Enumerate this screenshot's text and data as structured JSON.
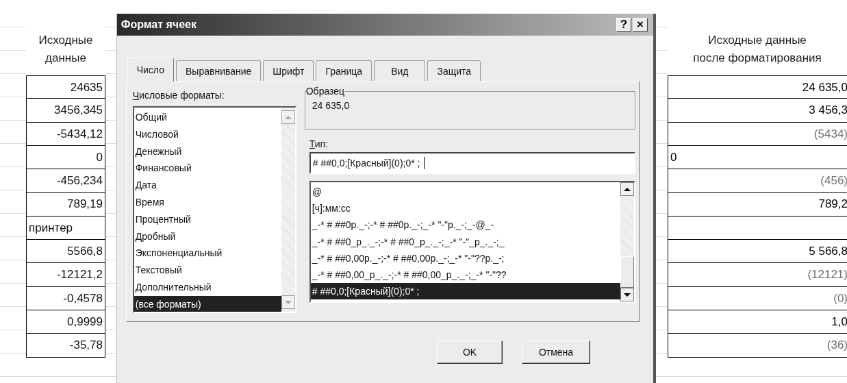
{
  "sheet_left": {
    "header": "Исходные\nданные",
    "cells": [
      {
        "text": "24635",
        "kind": "number"
      },
      {
        "text": "3456,345",
        "kind": "number"
      },
      {
        "text": "-5434,12",
        "kind": "number"
      },
      {
        "text": "0",
        "kind": "number"
      },
      {
        "text": "-456,234",
        "kind": "number"
      },
      {
        "text": "789,19",
        "kind": "number"
      },
      {
        "text": "принтер",
        "kind": "text"
      },
      {
        "text": "5566,8",
        "kind": "number"
      },
      {
        "text": "-12121,2",
        "kind": "number"
      },
      {
        "text": "-0,4578",
        "kind": "number"
      },
      {
        "text": "0,9999",
        "kind": "number"
      },
      {
        "text": "-35,78",
        "kind": "number"
      }
    ]
  },
  "dialog": {
    "title": "Формат ячеек",
    "help_button": "?",
    "close_button": "×",
    "tabs": [
      {
        "label": "Число",
        "selected": true
      },
      {
        "label": "Выравнивание",
        "selected": false
      },
      {
        "label": "Шрифт",
        "selected": false
      },
      {
        "label": "Граница",
        "selected": false
      },
      {
        "label": "Вид",
        "selected": false
      },
      {
        "label": "Защита",
        "selected": false
      }
    ],
    "categories_label": "Числовые форматы:",
    "categories": [
      {
        "label": "Общий",
        "selected": false
      },
      {
        "label": "Числовой",
        "selected": false
      },
      {
        "label": "Денежный",
        "selected": false
      },
      {
        "label": "Финансовый",
        "selected": false
      },
      {
        "label": "Дата",
        "selected": false
      },
      {
        "label": "Время",
        "selected": false
      },
      {
        "label": "Процентный",
        "selected": false
      },
      {
        "label": "Дробный",
        "selected": false
      },
      {
        "label": "Экспоненциальный",
        "selected": false
      },
      {
        "label": "Текстовый",
        "selected": false
      },
      {
        "label": "Дополнительный",
        "selected": false
      },
      {
        "label": "(все форматы)",
        "selected": true
      }
    ],
    "sample_label": "Образец",
    "sample_value": "24 635,0",
    "type_label": "Тип:",
    "type_value": "# ##0,0;[Красный](0);0* ;",
    "type_list": [
      {
        "label": "@",
        "selected": false
      },
      {
        "label": "[ч]:мм:сс",
        "selected": false
      },
      {
        "label": "_-* # ##0р._-;-* # ##0р._-;_-* \"-\"р._-;_-@_-",
        "selected": false
      },
      {
        "label": "_-* # ##0_р_._-;-* # ##0_р_._-;_-* \"-\"_р_._-;_",
        "selected": false
      },
      {
        "label": "_-* # ##0,00р._-;-* # ##0,00р._-;_-* \"-\"??р._-;",
        "selected": false
      },
      {
        "label": "_-* # ##0,00_р_._-;-* # ##0,00_р_._-;_-* \"-\"??",
        "selected": false
      },
      {
        "label": "# ##0,0;[Красный](0);0* ;",
        "selected": true
      }
    ],
    "ok_button": "OK",
    "cancel_button": "Отмена"
  },
  "sheet_right": {
    "header": "Исходные данные\nпосле форматирования",
    "cells": [
      {
        "kind": "number",
        "text": "24 635,0",
        "color": "#000000"
      },
      {
        "kind": "number",
        "text": "3 456,3",
        "color": "#000000"
      },
      {
        "kind": "number",
        "text": "(5434)",
        "color": "#6e6e6e"
      },
      {
        "kind": "text",
        "text": "0",
        "color": "#000000"
      },
      {
        "kind": "number",
        "text": "(456)",
        "color": "#6e6e6e"
      },
      {
        "kind": "number",
        "text": "789,2",
        "color": "#000000"
      },
      {
        "kind": "empty"
      },
      {
        "kind": "number",
        "text": "5 566,8",
        "color": "#000000"
      },
      {
        "kind": "number",
        "text": "(12121)",
        "color": "#6e6e6e"
      },
      {
        "kind": "number",
        "text": "(0)",
        "color": "#6e6e6e"
      },
      {
        "kind": "number",
        "text": "1,0",
        "color": "#000000"
      },
      {
        "kind": "number",
        "text": "(36)",
        "color": "#6e6e6e"
      }
    ]
  }
}
